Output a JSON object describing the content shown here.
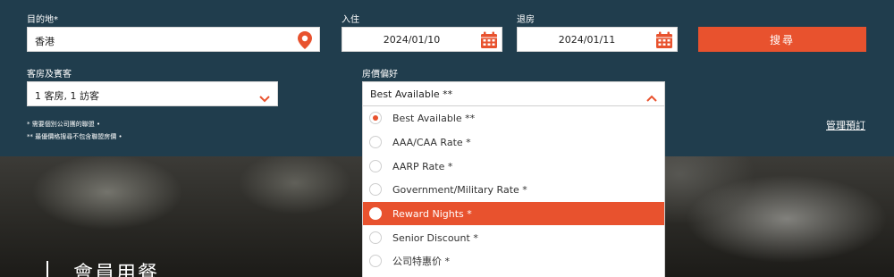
{
  "colors": {
    "panel": "#203d4d",
    "accent": "#e8522e",
    "selected_bg": "#e8522e"
  },
  "destination": {
    "label": "目的地*",
    "value": "香港",
    "icon": "map-pin-icon"
  },
  "checkin": {
    "label": "入住",
    "value": "2024/01/10",
    "icon": "calendar-icon"
  },
  "checkout": {
    "label": "退房",
    "value": "2024/01/11",
    "icon": "calendar-icon"
  },
  "search_button": "搜尋",
  "rooms": {
    "label": "客房及賓客",
    "value": "1 客房, 1 訪客",
    "icon": "chevron-down-icon"
  },
  "rate": {
    "label": "房價偏好",
    "value": "Best Available **",
    "icon": "chevron-up-icon"
  },
  "notes": [
    "* 需要個別公司團的聯盟 •",
    "** 最優價格搜尋不包含聯盟房價 •"
  ],
  "manage_link": "管理預訂",
  "rate_options": [
    {
      "label": "Best Available **",
      "checked": true,
      "highlighted": false
    },
    {
      "label": "AAA/CAA Rate *",
      "checked": false,
      "highlighted": false
    },
    {
      "label": "AARP Rate *",
      "checked": false,
      "highlighted": false
    },
    {
      "label": "Government/Military Rate *",
      "checked": false,
      "highlighted": false
    },
    {
      "label": "Reward Nights *",
      "checked": false,
      "highlighted": true
    },
    {
      "label": "Senior Discount *",
      "checked": false,
      "highlighted": false
    },
    {
      "label": "公司特惠价 *",
      "checked": false,
      "highlighted": false
    }
  ],
  "hero": {
    "title": "會員用餐"
  }
}
